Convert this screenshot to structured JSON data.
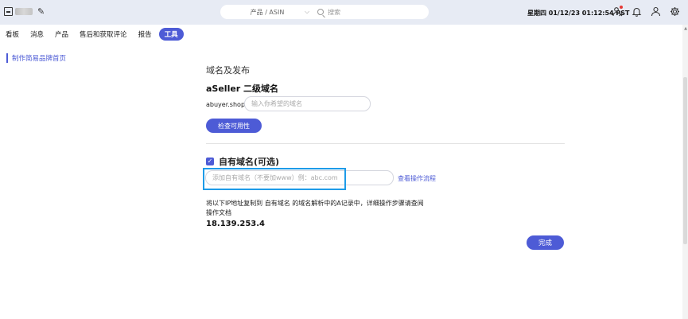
{
  "header": {
    "search_scope": "产品 / ASIN",
    "search_placeholder": "搜索",
    "datetime": "星期四 01/12/23 01:12:54 PST",
    "icons": [
      "person-alert-icon",
      "bell-icon",
      "user-icon",
      "gear-icon"
    ]
  },
  "nav": {
    "tabs": [
      {
        "label": "看板"
      },
      {
        "label": "消息"
      },
      {
        "label": "产品"
      },
      {
        "label": "售后和获取评论"
      },
      {
        "label": "报告"
      },
      {
        "label": "工具",
        "active": true
      }
    ]
  },
  "sidebar": {
    "active_item": "制作简易品牌首页"
  },
  "main": {
    "section_title": "域名及发布",
    "subdomain": {
      "title": "aSeller 二级域名",
      "prefix": "abuyer.shop/",
      "placeholder": "输入你希望的域名",
      "check_button": "检查可用性"
    },
    "own_domain": {
      "checked": true,
      "label": "自有域名(可选)",
      "placeholder": "添加自有域名（不要加www）例：abc.com",
      "guide_link": "查看操作流程",
      "description_line1": "将以下IP地址复制到 自有域名 的域名解析中的A记录中，详细操作步骤请查阅",
      "description_line2": "操作文档",
      "ip": "18.139.253.4"
    },
    "done_button": "完成"
  },
  "colors": {
    "accent": "#4d5bd6",
    "topbar_bg": "#e7ebf4",
    "focus_ring": "#1e9be8"
  }
}
